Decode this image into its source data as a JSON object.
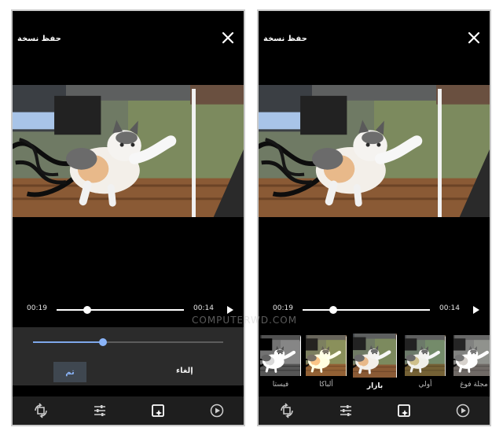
{
  "watermark": "COMPUTERWD.COM",
  "left": {
    "topbar": {
      "save_label": "حفظ نسخة",
      "close_icon": "close-icon"
    },
    "timeline": {
      "start": "00:19",
      "end": "00:14"
    },
    "adjust": {
      "done_label": "تم",
      "cancel_label": "إلغاء",
      "level": 0.37
    },
    "tools": [
      "rotate-icon",
      "sliders-icon",
      "filter-icon",
      "play-circle-icon"
    ]
  },
  "right": {
    "topbar": {
      "save_label": "حفظ نسخة",
      "close_icon": "close-icon"
    },
    "timeline": {
      "start": "00:19",
      "end": "00:14"
    },
    "filters": [
      {
        "label": "فيستا",
        "style": "bw"
      },
      {
        "label": "ألباكا",
        "style": "warm"
      },
      {
        "label": "بازار",
        "style": "normal",
        "selected": true
      },
      {
        "label": "أولي",
        "style": "cool"
      },
      {
        "label": "مجلة فوغ",
        "style": "mono"
      }
    ],
    "tools": [
      "rotate-icon",
      "sliders-icon",
      "filter-icon",
      "play-circle-icon"
    ]
  },
  "colors": {
    "accent": "#8ab4f8",
    "panel": "#2b2b2b",
    "bar": "#1e1e1e"
  }
}
